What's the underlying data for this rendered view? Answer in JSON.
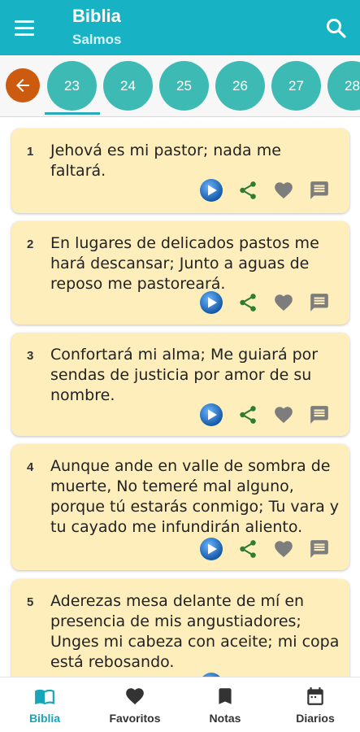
{
  "app_bar": {
    "title": "Biblia",
    "subtitle": "Salmos",
    "menu_icon": "hamburger-icon",
    "search_icon": "search-icon"
  },
  "chapters": {
    "back_icon": "arrow-left-icon",
    "items": [
      "23",
      "24",
      "25",
      "26",
      "27",
      "28"
    ],
    "selected": "23"
  },
  "verses": [
    {
      "number": "1",
      "text": "Jehová es mi pastor; nada me faltará."
    },
    {
      "number": "2",
      "text": "En lugares de delicados pastos me hará descansar; Junto a aguas de reposo me pastoreará."
    },
    {
      "number": "3",
      "text": "Confortará mi alma; Me guiará por sendas de justicia por amor de su nombre."
    },
    {
      "number": "4",
      "text": "Aunque ande en valle de sombra de muerte, No temeré mal alguno, porque tú estarás conmigo; Tu vara y tu cayado me infundirán aliento."
    },
    {
      "number": "5",
      "text": "Aderezas mesa delante de mí en presencia de mis angustiadores; Unges mi cabeza con aceite; mi copa está rebosando."
    }
  ],
  "verse_actions": [
    "play-icon",
    "share-icon",
    "heart-icon",
    "note-icon"
  ],
  "bottom_nav": [
    {
      "label": "Biblia",
      "icon": "book-icon",
      "active": true
    },
    {
      "label": "Favoritos",
      "icon": "heart-icon",
      "active": false
    },
    {
      "label": "Notas",
      "icon": "bookmark-icon",
      "active": false
    },
    {
      "label": "Diarios",
      "icon": "calendar-icon",
      "active": false
    }
  ],
  "colors": {
    "primary": "#17b3c5",
    "chip": "#3dbab3",
    "back": "#cc5b10",
    "card": "#fdeebb",
    "share": "#2e7d32",
    "icon_gray": "#7d7d7d",
    "active_tab": "#17a6b8"
  }
}
